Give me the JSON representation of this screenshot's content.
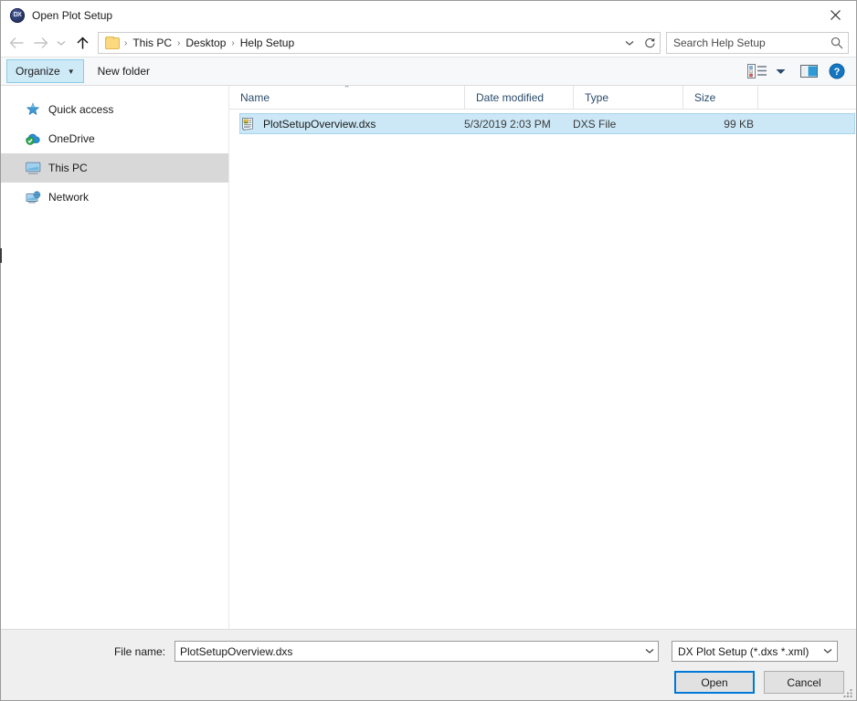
{
  "window": {
    "title": "Open Plot Setup",
    "icon": "dx-app-icon",
    "icon_text": "DX",
    "close_label": "✕"
  },
  "nav": {
    "back": "back-arrow",
    "forward": "forward-arrow",
    "recent": "recent-locations-chevron",
    "up": "up-arrow",
    "breadcrumb": {
      "folder_icon": "folder-icon",
      "crumbs": [
        "This PC",
        "Desktop",
        "Help Setup"
      ],
      "separator": "›",
      "dropdown": "chevron-down-icon",
      "refresh": "refresh-icon"
    }
  },
  "search": {
    "placeholder": "Search Help Setup",
    "value": "",
    "icon": "search-icon"
  },
  "toolbar": {
    "organize_label": "Organize",
    "organize_caret": "▼",
    "new_folder_label": "New folder",
    "view_icon": "view-mode-icon",
    "view_caret": "▼",
    "preview_pane_icon": "preview-pane-icon",
    "help_icon": "help-icon"
  },
  "sidebar": {
    "items": [
      {
        "label": "Quick access",
        "icon": "star-icon",
        "selected": false
      },
      {
        "label": "OneDrive",
        "icon": "onedrive-cloud-icon",
        "selected": false
      },
      {
        "label": "This PC",
        "icon": "computer-icon",
        "selected": true
      },
      {
        "label": "Network",
        "icon": "network-icon",
        "selected": false
      }
    ]
  },
  "filelist": {
    "columns": [
      {
        "key": "name",
        "label": "Name",
        "sorted": true,
        "sort_dir": "asc",
        "sort_mark": "⌃"
      },
      {
        "key": "date",
        "label": "Date modified",
        "sorted": false
      },
      {
        "key": "type",
        "label": "Type",
        "sorted": false
      },
      {
        "key": "size",
        "label": "Size",
        "sorted": false
      }
    ],
    "rows": [
      {
        "name": "PlotSetupOverview.dxs",
        "date": "5/3/2019 2:03 PM",
        "type": "DXS File",
        "size": "99 KB",
        "icon": "dxs-document-icon",
        "selected": true
      }
    ]
  },
  "footer": {
    "file_name_label": "File name:",
    "file_name_value": "PlotSetupOverview.dxs",
    "file_name_caret": "chevron-down-icon",
    "file_type_value": "DX Plot Setup (*.dxs *.xml)",
    "file_type_caret": "chevron-down-icon",
    "open_label": "Open",
    "cancel_label": "Cancel",
    "resize_grip": "resize-grip"
  },
  "colors": {
    "accent": "#0078d7",
    "selection_fill": "#cce8f7",
    "selection_border": "#a7d4ea",
    "sidebar_selected": "#d8d8d8",
    "toolbar_bg": "#f7f8f9",
    "footer_bg": "#efefef",
    "header_text": "#2a4b6b"
  }
}
